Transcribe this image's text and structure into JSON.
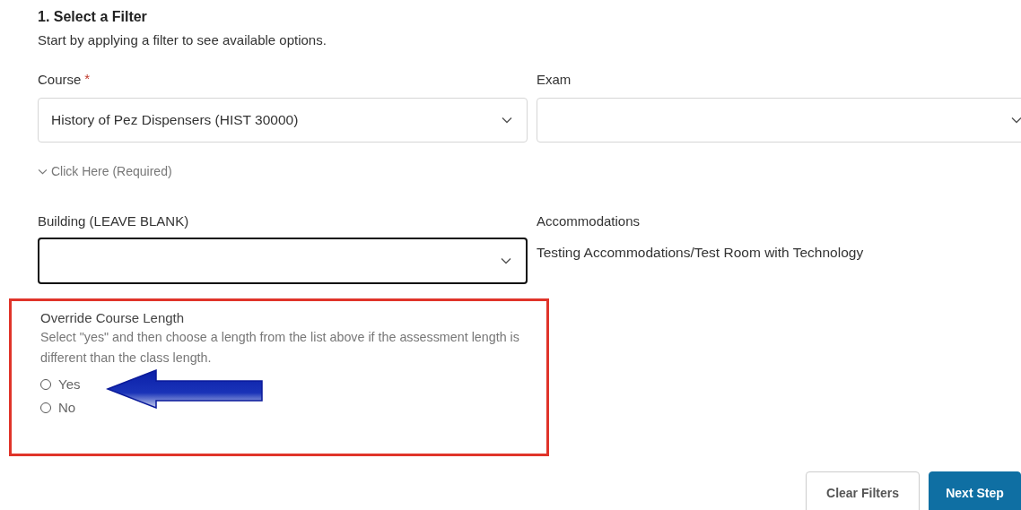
{
  "section": {
    "title": "1. Select a Filter",
    "subtitle": "Start by applying a filter to see available options."
  },
  "course": {
    "label": "Course",
    "required_mark": "*",
    "value": "History of Pez Dispensers (HIST 30000)"
  },
  "exam": {
    "label": "Exam"
  },
  "disclosure": {
    "label": "Click Here (Required)",
    "expanded": false
  },
  "building": {
    "label": "Building (LEAVE BLANK)",
    "focused": true
  },
  "accommodations": {
    "label": "Accommodations",
    "value": "Testing Accommodations/Test Room with Technology"
  },
  "override": {
    "label": "Override Course Length",
    "help": "Select \"yes\" and then choose a length from the list above if the assessment length is different than the class length.",
    "highlighted": true,
    "options": [
      {
        "label": "Yes",
        "selected": false
      },
      {
        "label": "No",
        "selected": false
      }
    ]
  },
  "buttons": [
    {
      "label": "Clear Filters",
      "kind": "secondary"
    },
    {
      "label": "Next Step",
      "kind": "primary"
    }
  ]
}
